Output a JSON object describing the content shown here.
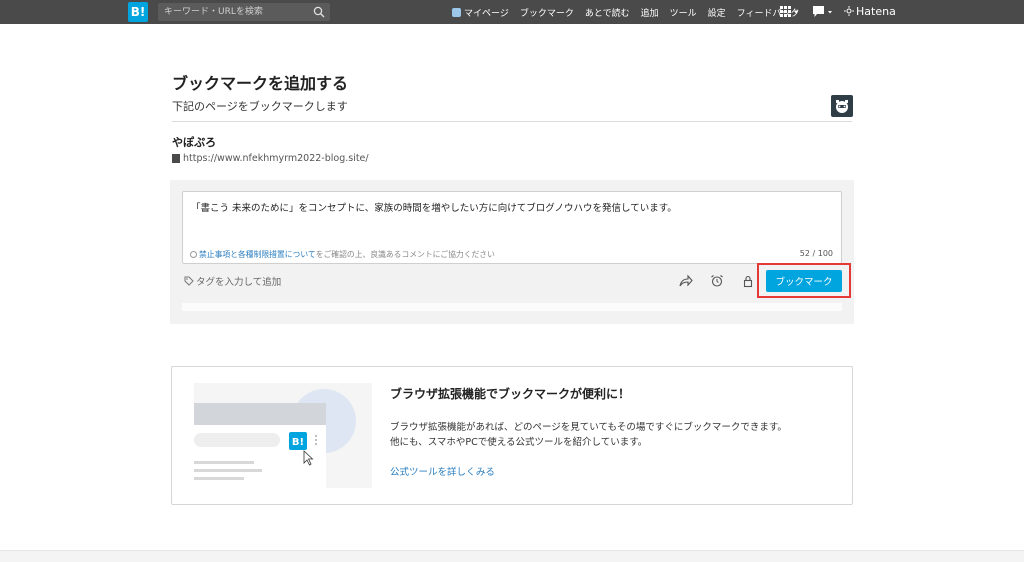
{
  "topbar": {
    "logo": "B!",
    "search_placeholder": "キーワード・URLを検索",
    "nav": [
      "マイページ",
      "ブックマーク",
      "あとで読む",
      "追加",
      "ツール",
      "設定",
      "フィードバック"
    ],
    "hatena": "Hatena",
    "colors": {
      "bar": "#4a4a4a",
      "brand": "#00a4de"
    }
  },
  "page": {
    "title": "ブックマークを追加する",
    "subtitle": "下記のページをブックマークします"
  },
  "entry": {
    "site_title": "やぽぷろ",
    "url": "https://www.nfekhmyrm2022-blog.site/"
  },
  "comment": {
    "value": "「書こう 未来のために」をコンセプトに、家族の時間を増やしたい方に向けてブログノウハウを発信しています。",
    "notice_link": "禁止事項と各種制限措置について",
    "notice_rest": "をご確認の上、良識あるコメントにご協力ください",
    "counter": "52 / 100"
  },
  "tags": {
    "placeholder": "タグを入力して追加"
  },
  "actions": {
    "icons": [
      "share-icon",
      "alarm-icon",
      "lock-icon"
    ],
    "bookmark_button": "ブックマーク",
    "highlight_color": "#e53935"
  },
  "promo": {
    "title": "ブラウザ拡張機能でブックマークが便利に！",
    "desc1": "ブラウザ拡張機能があれば、どのページを見ていてもその場ですぐにブックマークできます。",
    "desc2": "他にも、スマホやPCで使える公式ツールを紹介しています。",
    "link": "公式ツールを詳しくみる",
    "badge": "B!"
  }
}
